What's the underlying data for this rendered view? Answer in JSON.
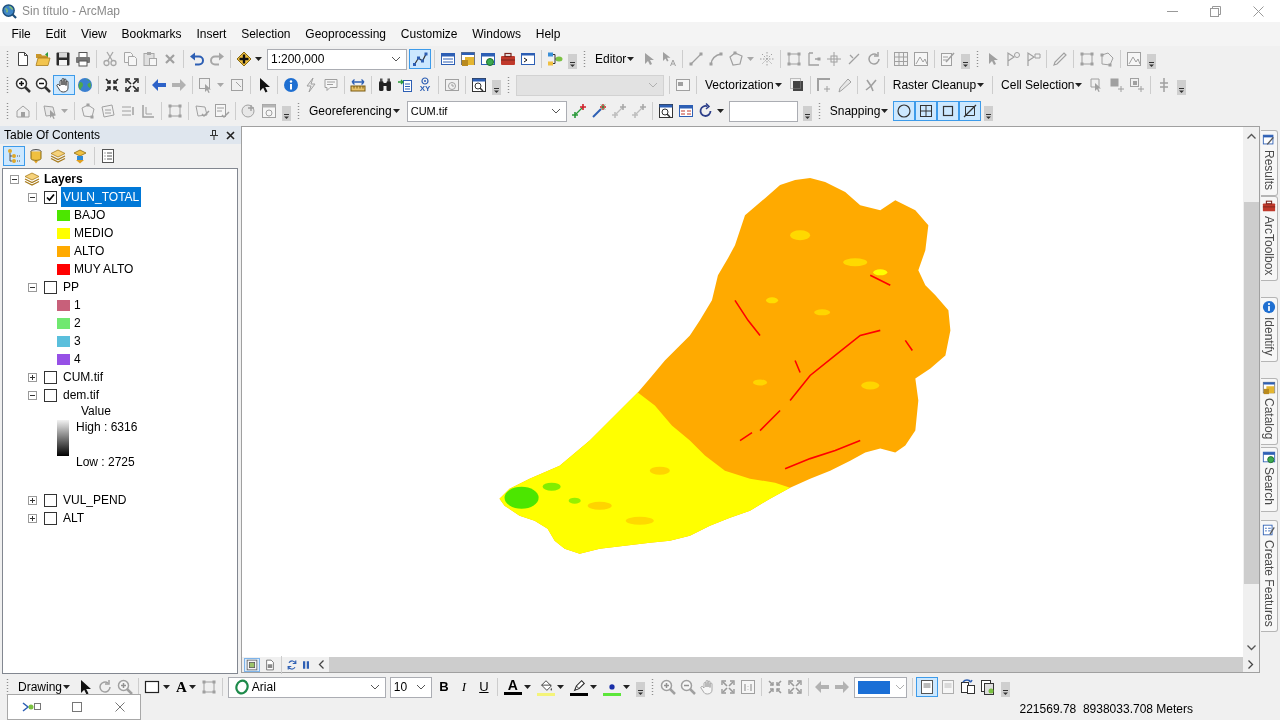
{
  "window": {
    "title": "Sin título - ArcMap"
  },
  "menu_bar": [
    "File",
    "Edit",
    "View",
    "Bookmarks",
    "Insert",
    "Selection",
    "Geoprocessing",
    "Customize",
    "Windows",
    "Help"
  ],
  "standard_toolbar": {
    "scale": "1:200,000",
    "editor_toolbar_on": true
  },
  "editor_toolbar": {
    "label": "Editor"
  },
  "tools_toolbar": {
    "pan_selected": true,
    "go_to_xy": "XY"
  },
  "vectorization_toolbar": {
    "label": "Vectorization"
  },
  "raster_cleanup_toolbar": {
    "label": "Raster Cleanup"
  },
  "cell_selection_toolbar": {
    "label": "Cell Selection"
  },
  "georeferencing_toolbar": {
    "label": "Georeferencing",
    "layer": "CUM.tif"
  },
  "snapping_toolbar": {
    "label": "Snapping",
    "options": [
      {
        "on": true
      },
      {
        "on": true
      },
      {
        "on": true
      },
      {
        "on": true
      }
    ]
  },
  "table_of_contents": {
    "title": "Table Of Contents",
    "views": [
      {
        "selected": true
      },
      {
        "selected": false
      },
      {
        "selected": false
      },
      {
        "selected": false
      }
    ],
    "root": {
      "name": "Layers",
      "expanded": true
    },
    "layers": [
      {
        "name": "VULN_TOTAL",
        "checked": true,
        "expanded": true,
        "selected": true,
        "legend": [
          {
            "label": "BAJO",
            "color": "#4ce600"
          },
          {
            "label": "MEDIO",
            "color": "#ffff00"
          },
          {
            "label": "ALTO",
            "color": "#ffaa00"
          },
          {
            "label": "MUY ALTO",
            "color": "#ff0000"
          }
        ]
      },
      {
        "name": "PP",
        "checked": false,
        "expanded": true,
        "selected": false,
        "legend": [
          {
            "label": "1",
            "color": "#c8607a"
          },
          {
            "label": "2",
            "color": "#70e870"
          },
          {
            "label": "3",
            "color": "#5abfdc"
          },
          {
            "label": "4",
            "color": "#9650e6"
          }
        ]
      },
      {
        "name": "CUM.tif",
        "checked": false,
        "expanded": false,
        "selected": false
      },
      {
        "name": "dem.tif",
        "checked": false,
        "expanded": true,
        "selected": false,
        "ramp": {
          "field": "Value",
          "high": "High : 6316",
          "low": "Low : 2725"
        }
      },
      {
        "name": "VUL_PEND",
        "checked": false,
        "expanded": false,
        "selected": false
      },
      {
        "name": "ALT",
        "checked": false,
        "expanded": false,
        "selected": false
      }
    ]
  },
  "map_view": {
    "views": [
      {
        "selected": true
      },
      {
        "selected": false
      }
    ]
  },
  "side_tabs": [
    "Results",
    "ArcToolbox",
    "Identify",
    "Catalog",
    "Search",
    "Create Features"
  ],
  "drawing_toolbar": {
    "label": "Drawing",
    "text_tool": "A",
    "font": "Arial",
    "font_size": "10",
    "bold": "B",
    "italic": "I",
    "underline": "U",
    "font_color": "A"
  },
  "layout_toolbar": {
    "draft_mode_on": true
  },
  "status_bar": {
    "coordinates": "221569.78  8938033.708 Meters"
  }
}
